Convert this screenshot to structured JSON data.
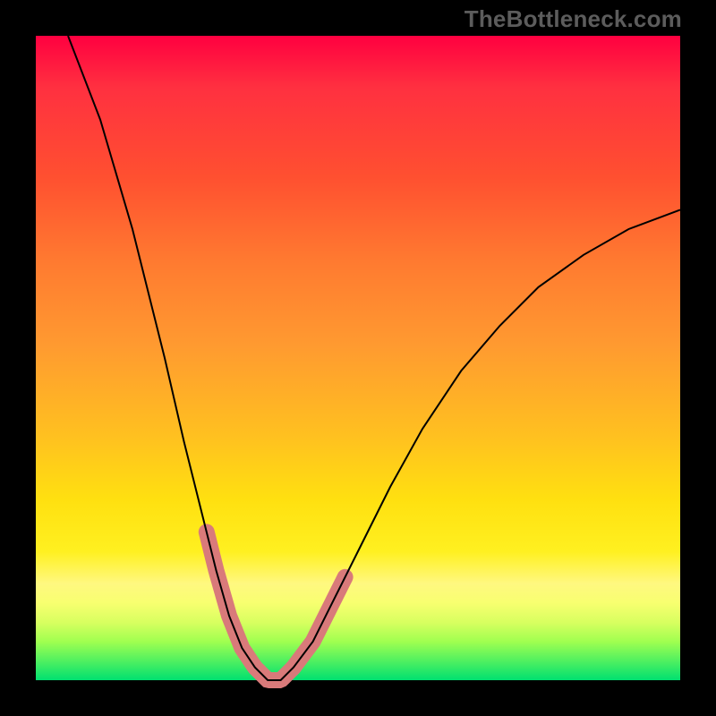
{
  "attribution": "TheBottleneck.com",
  "chart_data": {
    "type": "line",
    "title": "",
    "xlabel": "",
    "ylabel": "",
    "ylim": [
      0,
      100
    ],
    "xlim": [
      0,
      100
    ],
    "series": [
      {
        "name": "bottleneck-curve",
        "x": [
          5,
          10,
          15,
          20,
          23,
          26,
          28,
          30,
          32,
          34,
          36,
          38,
          40,
          43,
          46,
          50,
          55,
          60,
          66,
          72,
          78,
          85,
          92,
          100
        ],
        "y": [
          100,
          87,
          70,
          50,
          37,
          25,
          17,
          10,
          5,
          2,
          0,
          0,
          2,
          6,
          12,
          20,
          30,
          39,
          48,
          55,
          61,
          66,
          70,
          73
        ]
      }
    ],
    "highlight_segments": [
      {
        "name": "left-band",
        "x_range": [
          26.5,
          32.5
        ]
      },
      {
        "name": "valley-band",
        "x_range": [
          32.5,
          40
        ]
      },
      {
        "name": "right-band",
        "x_range": [
          40,
          48
        ]
      }
    ],
    "gradient_stops": [
      {
        "pos": 0.0,
        "color": "#ff0040"
      },
      {
        "pos": 0.35,
        "color": "#ff7a30"
      },
      {
        "pos": 0.72,
        "color": "#ffe010"
      },
      {
        "pos": 0.88,
        "color": "#f8ff70"
      },
      {
        "pos": 1.0,
        "color": "#00e070"
      }
    ]
  }
}
